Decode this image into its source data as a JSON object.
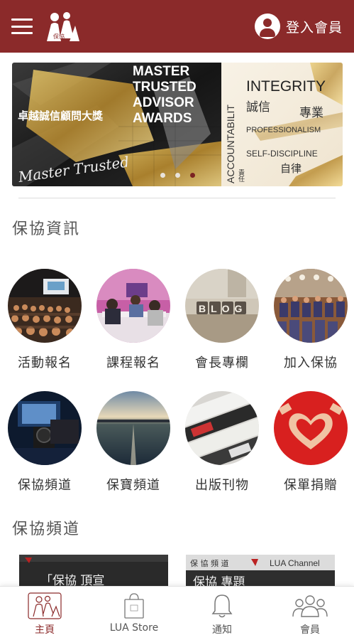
{
  "header": {
    "logo_text": "保協",
    "login_label": "登入會員"
  },
  "banner": {
    "left_caption": "卓越誠信顧問大獎",
    "headline": [
      "MASTER",
      "TRUSTED",
      "ADVISOR",
      "AWARDS"
    ],
    "script_text": "Master Trusted",
    "vertical_word": "ACCOUNTABILIT",
    "vertical_cn": "責任",
    "words": {
      "integrity": "INTEGRITY",
      "integrity_cn": "誠信",
      "professional_cn": "專業",
      "professionalism": "PROFESSIONALISM",
      "self_discipline": "SELF-DISCIPLINE",
      "self_discipline_cn": "自律"
    },
    "slides": 3,
    "active_slide": 3
  },
  "sections": {
    "info_title": "保協資訊",
    "channel_title": "保協頻道"
  },
  "grid": [
    {
      "label": "活動報名",
      "icon": "event-photo"
    },
    {
      "label": "課程報名",
      "icon": "course-photo"
    },
    {
      "label": "會長專欄",
      "icon": "blog-photo",
      "photo_text": "BLOG"
    },
    {
      "label": "加入保協",
      "icon": "join-photo"
    },
    {
      "label": "保協頻道",
      "icon": "channel-photo"
    },
    {
      "label": "保寶頻道",
      "icon": "sunset-photo"
    },
    {
      "label": "出版刊物",
      "icon": "newspaper-photo"
    },
    {
      "label": "保單捐贈",
      "icon": "heart-hands-photo"
    }
  ],
  "channel_cards": [
    {
      "text": "「保協 頂宣"
    },
    {
      "header": "保 協 頻 道",
      "brand": "LUA Channel",
      "text": "保協 專題"
    }
  ],
  "bottom_nav": [
    {
      "label": "主頁",
      "icon": "home-logo-icon",
      "active": true
    },
    {
      "label": "LUA Store",
      "icon": "shopping-bag-icon",
      "active": false
    },
    {
      "label": "通知",
      "icon": "bell-icon",
      "active": false
    },
    {
      "label": "會員",
      "icon": "members-icon",
      "active": false
    }
  ],
  "colors": {
    "brand": "#8b2a2a",
    "gold": "#c9a64a"
  }
}
